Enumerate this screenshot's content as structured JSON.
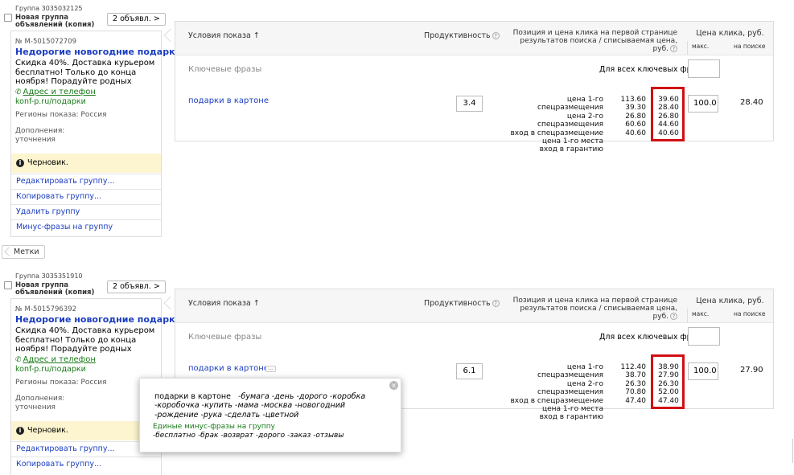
{
  "groups": [
    {
      "group_id": "Группа 3035032125",
      "group_title": "Новая группа объявлений (копия)",
      "ads_count": "2 объявл. >",
      "ad_number": "№ M-5015072709",
      "ad_title": "Недорогие новогодние подарки!",
      "ad_text": "Скидка 40%. Доставка курьером бесплатно! Только до конца ноября! Порадуйте родных",
      "address": "Адрес и телефон",
      "display_url": "konf-p.ru/подарки",
      "regions": "Регионы показа: Россия",
      "additions": "Дополнения:",
      "additions_value": "уточнения",
      "draft": "Черновик.",
      "actions": [
        "Редактировать группу...",
        "Копировать группу...",
        "Удалить группу",
        "Минус-фразы на группу"
      ],
      "table": {
        "keyword": "подарки в картоне",
        "productivity": "3.4",
        "bid_labels": [
          "цена 1-го спецразмещения",
          "цена 2-го спецразмещения",
          "вход в спецразмещение",
          "цена 1-го места",
          "вход в гарантию"
        ],
        "bid_values": [
          "113.60",
          "39.30",
          "26.80",
          "60.60",
          "40.60"
        ],
        "charged_values": [
          "39.60",
          "28.40",
          "26.80",
          "44.60",
          "40.60"
        ],
        "max_bid": "100.0",
        "on_search": "28.40"
      }
    },
    {
      "group_id": "Группа 3035351910",
      "group_title": "Новая группа объявлений (копия)",
      "ads_count": "2 объявл. >",
      "ad_number": "№ M-5015796392",
      "ad_title": "Недорогие новогодние подарки!",
      "ad_text": "Скидка 40%. Доставка курьером бесплатно! Только до конца ноября! Порадуйте родных",
      "address": "Адрес и телефон",
      "display_url": "konf-p.ru/подарки",
      "regions": "Регионы показа: Россия",
      "additions": "Дополнения:",
      "additions_value": "уточнения",
      "draft": "Черновик.",
      "actions": [
        "Редактировать группу...",
        "Копировать группу..."
      ],
      "table": {
        "keyword": "подарки в картоне",
        "productivity": "6.1",
        "bid_labels": [
          "цена 1-го спецразмещения",
          "цена 2-го спецразмещения",
          "вход в спецразмещение",
          "цена 1-го места",
          "вход в гарантию"
        ],
        "bid_values": [
          "112.40",
          "38.70",
          "26.30",
          "70.80",
          "47.40"
        ],
        "charged_values": [
          "38.90",
          "27.90",
          "26.30",
          "52.00",
          "47.40"
        ],
        "max_bid": "100.0",
        "on_search": "27.90"
      }
    }
  ],
  "table_header": {
    "conditions": "Условия показа",
    "conditions_sort": "↑",
    "productivity": "Продуктивность",
    "position_line1": "Позиция и цена клика на первой странице",
    "position_line2": "результатов поиска / списываемая цена, руб.",
    "price": "Цена клика, руб.",
    "max": "макс.",
    "on_search": "на поиске",
    "keywords_label": "Ключевые фразы",
    "all_keywords_label": "Для всех ключевых фраз:"
  },
  "marks_label": "Метки",
  "popup": {
    "keyword": "подарки в картоне",
    "minus_words": "-бумага -день -дорого -коробка -коробочка -купить -мама -москва -новогодний -рождение -рука -сделать -цветной",
    "group_minus_label": "Единые минус-фразы на группу",
    "group_minus_words": "-бесплатно -брак -возврат -дорого -заказ -отзывы",
    "dots": "…"
  },
  "icons": {
    "info": "info-icon",
    "help": "question-icon",
    "phone": "phone-icon",
    "close": "close-icon"
  },
  "colors": {
    "link": "#1a3dc1",
    "green": "#1a7a1a",
    "highlight": "#d10e14",
    "draft_bg": "#fcf5cf"
  }
}
